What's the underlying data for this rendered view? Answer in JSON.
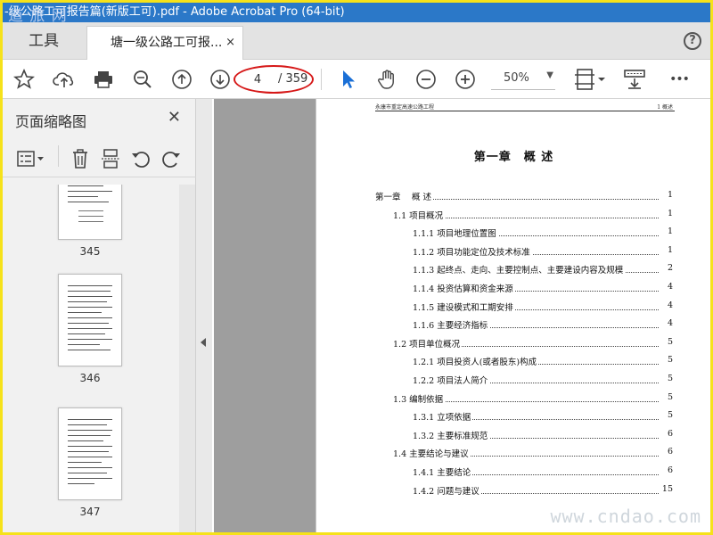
{
  "window": {
    "title": "-级公路工可报告篇(新版工可).pdf - Adobe Acrobat Pro (64-bit)",
    "watermark_top": "道 旅 网"
  },
  "tabs": {
    "tools_label": "工具",
    "doc_label": "塘一级公路工可报...",
    "close_glyph": "×",
    "help_glyph": "?"
  },
  "toolbar": {
    "page_current": "4",
    "page_total": "/ 359",
    "zoom": "50%",
    "zoom_arrow": "▼",
    "more_glyph": "•••"
  },
  "sidebar": {
    "title": "页面缩略图",
    "close_glyph": "✕",
    "thumbnails": [
      {
        "number": "345"
      },
      {
        "number": "346"
      },
      {
        "number": "347"
      }
    ]
  },
  "document": {
    "header_left": "永康市重定高速公路工程",
    "header_right": "1 概述",
    "chapter_title": "第一章　概 述",
    "toc": [
      {
        "label": "第一章　 概 述",
        "page": "1",
        "level": 0
      },
      {
        "label": "1.1 项目概况",
        "page": "1",
        "level": 1
      },
      {
        "label": "1.1.1 项目地理位置图",
        "page": "1",
        "level": 2
      },
      {
        "label": "1.1.2 项目功能定位及技术标准",
        "page": "1",
        "level": 2
      },
      {
        "label": "1.1.3 起终点、走向、主要控制点、主要建设内容及规模",
        "page": "2",
        "level": 2
      },
      {
        "label": "1.1.4 投资估算和资金来源",
        "page": "4",
        "level": 2
      },
      {
        "label": "1.1.5 建设模式和工期安排",
        "page": "4",
        "level": 2
      },
      {
        "label": "1.1.6 主要经济指标",
        "page": "4",
        "level": 2
      },
      {
        "label": "1.2 项目单位概况",
        "page": "5",
        "level": 1
      },
      {
        "label": "1.2.1 项目投资人(或者股东)构成",
        "page": "5",
        "level": 2
      },
      {
        "label": "1.2.2 项目法人简介",
        "page": "5",
        "level": 2
      },
      {
        "label": "1.3 编制依据",
        "page": "5",
        "level": 1
      },
      {
        "label": "1.3.1 立项依据",
        "page": "5",
        "level": 2
      },
      {
        "label": "1.3.2 主要标准规范",
        "page": "6",
        "level": 2
      },
      {
        "label": "1.4 主要结论与建议",
        "page": "6",
        "level": 1
      },
      {
        "label": "1.4.1 主要结论",
        "page": "6",
        "level": 2
      },
      {
        "label": "1.4.2 问题与建议",
        "page": "15",
        "level": 2
      }
    ]
  },
  "watermark_bottom": "www.cndao.com",
  "colors": {
    "titlebar": "#2b78c8",
    "frame_border": "#f6e21a",
    "annotation_circle": "#d61818",
    "cursor_blue": "#1a6fd6"
  }
}
